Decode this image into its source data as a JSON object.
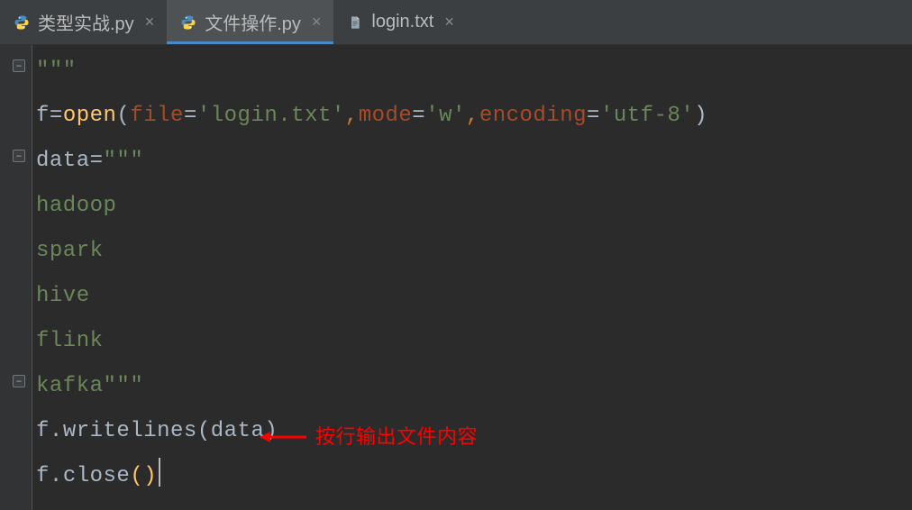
{
  "tabs": [
    {
      "label": "类型实战.py",
      "icon": "python",
      "active": false
    },
    {
      "label": "文件操作.py",
      "icon": "python",
      "active": true
    },
    {
      "label": "login.txt",
      "icon": "text",
      "active": false
    }
  ],
  "code": {
    "l1_quotes": "\"\"\"",
    "l2_a": "f",
    "l2_b": "=",
    "l2_open": "open",
    "l2_lp": "(",
    "l2_file_k": "file",
    "l2_eq1": "=",
    "l2_file_v": "'login.txt'",
    "l2_c1": ",",
    "l2_mode_k": "mode",
    "l2_eq2": "=",
    "l2_mode_v": "'w'",
    "l2_c2": ",",
    "l2_enc_k": "encoding",
    "l2_eq3": "=",
    "l2_enc_v": "'utf-8'",
    "l2_rp": ")",
    "l3_a": "data",
    "l3_b": "=",
    "l3_q": "\"\"\"",
    "l4": "hadoop",
    "l5": "spark",
    "l6": "hive",
    "l7": "flink",
    "l8_a": "kafka",
    "l8_q": "\"\"\"",
    "l9_a": "f",
    "l9_b": ".",
    "l9_c": "writelines",
    "l9_d": "(data)",
    "l10_a": "f",
    "l10_b": ".",
    "l10_c": "close",
    "l10_lp": "(",
    "l10_rp": ")"
  },
  "annotation": {
    "text": "按行输出文件内容",
    "color": "#ff0000"
  }
}
